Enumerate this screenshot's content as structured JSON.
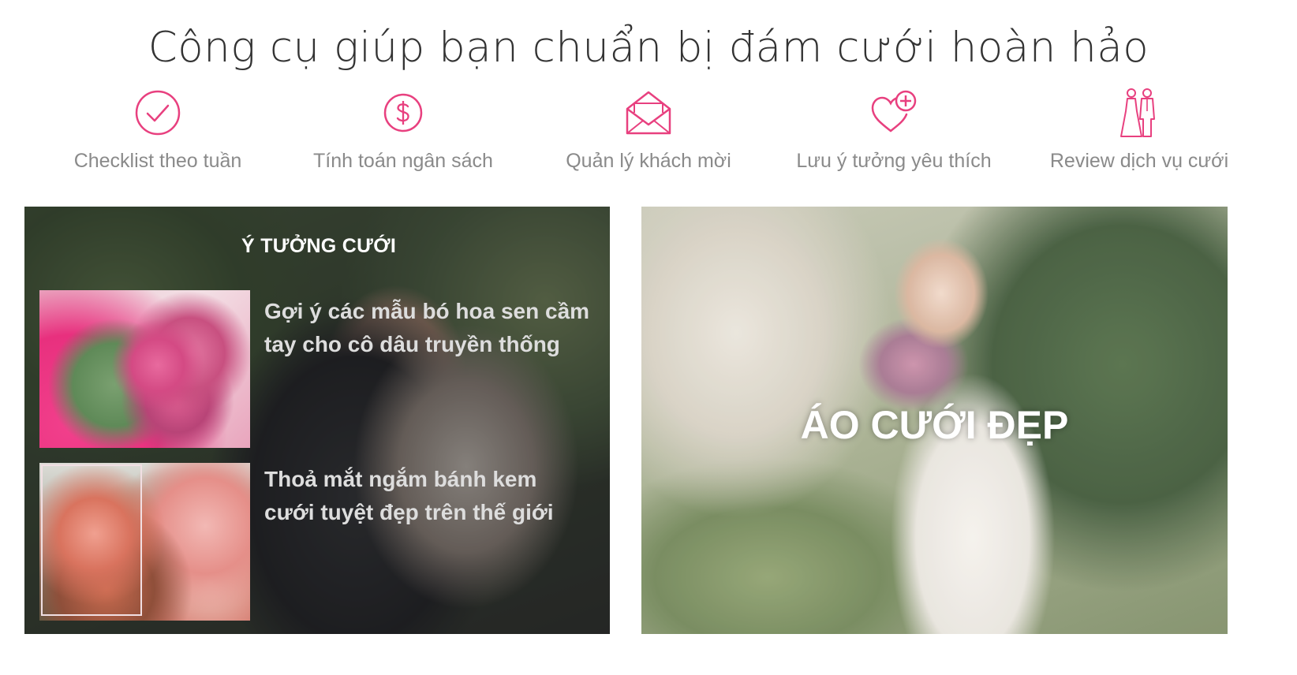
{
  "header": {
    "title": "Công cụ giúp bạn chuẩn bị đám cưới hoàn hảo"
  },
  "tools": [
    {
      "label": "Checklist theo tuần",
      "icon": "check-circle-icon"
    },
    {
      "label": "Tính toán ngân sách",
      "icon": "dollar-circle-icon"
    },
    {
      "label": "Quản lý khách mời",
      "icon": "envelope-icon"
    },
    {
      "label": "Lưu ý tưởng yêu thích",
      "icon": "heart-plus-icon"
    },
    {
      "label": "Review dịch vụ cưới",
      "icon": "bride-groom-icon"
    }
  ],
  "ideas": {
    "heading": "Ý TƯỞNG CƯỚI",
    "articles": [
      {
        "title": "Gợi ý các mẫu bó hoa sen cầm tay cho cô dâu truyền thống"
      },
      {
        "title": "Thoả mắt ngắm bánh kem cưới tuyệt đẹp trên thế giới"
      }
    ]
  },
  "dress": {
    "title": "ÁO CƯỚI ĐẸP"
  },
  "colors": {
    "accent": "#e8407f",
    "label": "#8a8a8a",
    "title": "#333333"
  }
}
